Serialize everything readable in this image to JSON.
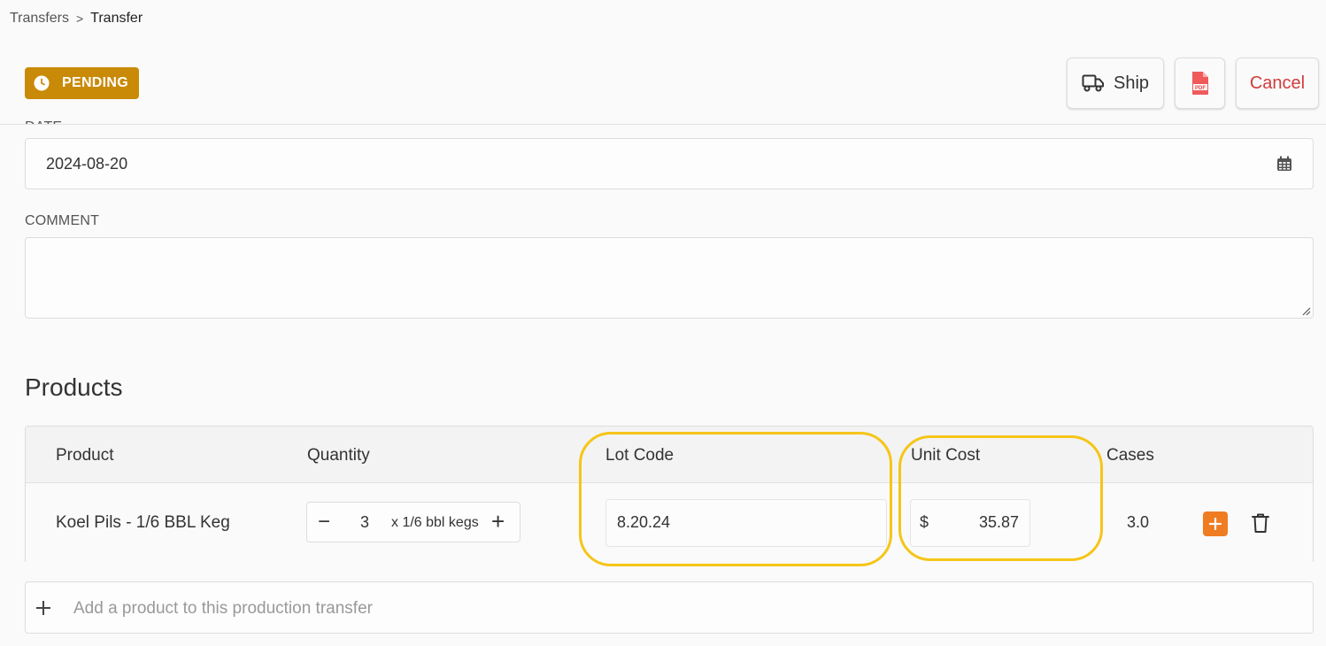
{
  "breadcrumb": {
    "parent": "Transfers",
    "separator": ">",
    "current": "Transfer"
  },
  "status": {
    "label": "PENDING",
    "color": "#c98a08",
    "icon": "clock-icon"
  },
  "actions": {
    "ship_label": "Ship",
    "pdf_icon": "pdf-file-icon",
    "cancel_label": "Cancel"
  },
  "form": {
    "date_label": "DATE",
    "date_value": "2024-08-20",
    "comment_label": "COMMENT",
    "comment_value": ""
  },
  "products": {
    "title": "Products",
    "columns": [
      "Product",
      "Quantity",
      "Lot Code",
      "Unit Cost",
      "Cases"
    ],
    "rows": [
      {
        "product": "Koel Pils - 1/6 BBL Keg",
        "quantity": "3",
        "unit": "x 1/6 bbl kegs",
        "lot_code": "8.20.24",
        "currency": "$",
        "unit_cost": "35.87",
        "cases": "3.0"
      }
    ],
    "add_placeholder": "Add a product to this production transfer"
  },
  "colors": {
    "accent_orange": "#f07c22",
    "cancel_red": "#d23b3b",
    "highlight_yellow": "#f5c518"
  }
}
